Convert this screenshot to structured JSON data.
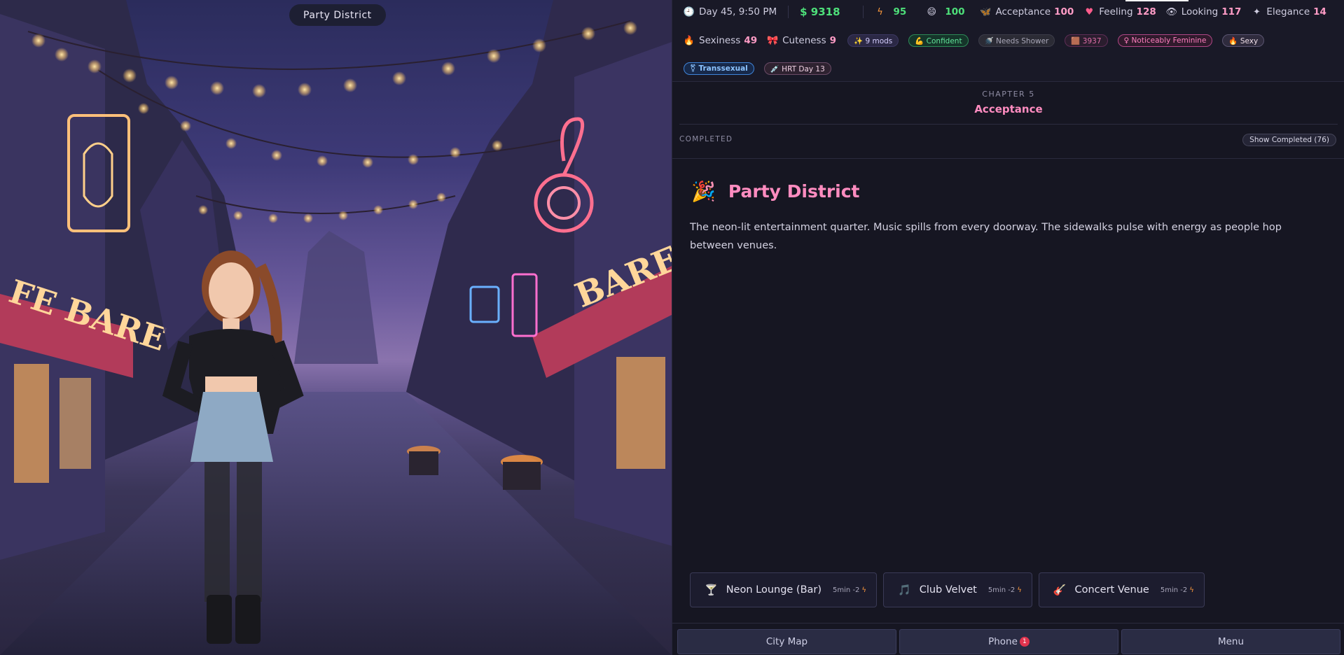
{
  "scene": {
    "location_label": "Party District"
  },
  "status": {
    "time": "Day 45, 9:50 PM",
    "money": "$ 9318",
    "energy": "95",
    "mood": "100",
    "stats_row1": [
      {
        "label": "Acceptance",
        "value": "100",
        "icon": "butterfly-icon"
      },
      {
        "label": "Feeling",
        "value": "128",
        "icon": "heart-icon"
      },
      {
        "label": "Looking",
        "value": "117",
        "icon": "eye-icon"
      },
      {
        "label": "Elegance",
        "value": "14",
        "icon": "sparkle-icon"
      }
    ],
    "stats_row2": [
      {
        "label": "Sexiness",
        "value": "49",
        "icon": "fire-icon"
      },
      {
        "label": "Cuteness",
        "value": "9",
        "icon": "ribbon-icon"
      }
    ],
    "badges": {
      "mods": "✨ 9 mods",
      "confident": "💪 Confident",
      "needs_shower": "🚿 Needs Shower",
      "code": "🟫 3937",
      "feminine": "♀ Noticeably Feminine",
      "sexy": "🔥 Sexy",
      "transsexual": "⚧ Transsexual",
      "hrt": "💉 HRT Day 13"
    }
  },
  "chapter": {
    "label": "CHAPTER 5",
    "title": "Acceptance"
  },
  "completed": {
    "label": "COMPLETED",
    "button": "Show Completed (76)"
  },
  "location": {
    "icon": "🎉",
    "title": "Party District",
    "description": "The neon-lit entertainment quarter. Music spills from every doorway. The sidewalks pulse with energy as people hop between venues."
  },
  "actions": [
    {
      "icon": "🍸",
      "name": "Neon Lounge (Bar)",
      "meta": "5min -2"
    },
    {
      "icon": "🎵",
      "name": "Club Velvet",
      "meta": "5min -2"
    },
    {
      "icon": "🎸",
      "name": "Concert Venue",
      "meta": "5min -2"
    }
  ],
  "bottom": {
    "city_map": "City Map",
    "phone": "Phone",
    "phone_badge": "1",
    "menu": "Menu"
  },
  "colors": {
    "accent_pink": "#ff8cc0",
    "money_green": "#4ee07a",
    "panel_bg": "#161622"
  }
}
